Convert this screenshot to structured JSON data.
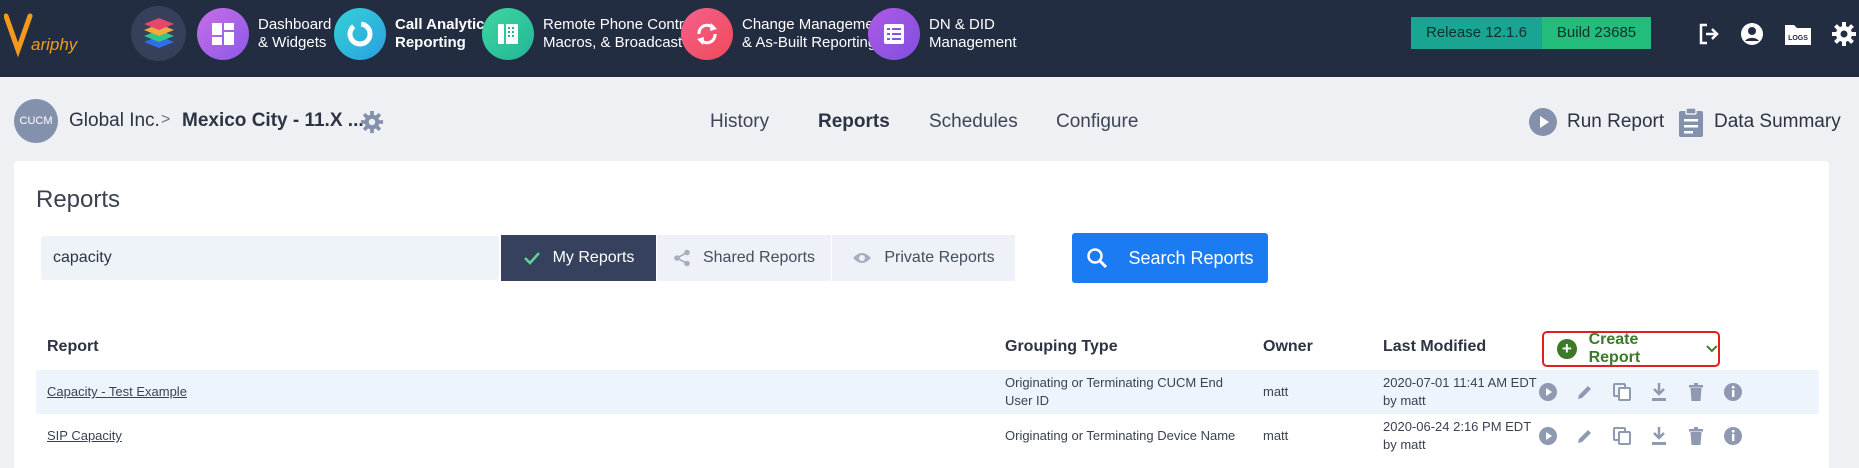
{
  "brand": {
    "name": "VARIPHY"
  },
  "topnav": [
    {
      "line1": "Dashboard",
      "line2": "& Widgets",
      "color": "#b65de6",
      "icon": "dashboard-icon"
    },
    {
      "line1": "Call Analytics",
      "line2": "Reporting",
      "color": "#2bc4d8",
      "icon": "call-analytics-icon",
      "active": true
    },
    {
      "line1": "Remote Phone Control,",
      "line2": "Macros, & Broadcast",
      "color": "#2ec79a",
      "icon": "remote-phone-icon"
    },
    {
      "line1": "Change Management",
      "line2": "& As-Built Reporting",
      "color": "#f0536d",
      "icon": "change-management-icon"
    },
    {
      "line1": "DN & DID",
      "line2": "Management",
      "color": "#9c4fe0",
      "icon": "dn-did-icon"
    }
  ],
  "release": {
    "release_label": "Release 12.1.6",
    "build_label": "Build 23685"
  },
  "top_icons": [
    "logout-icon",
    "user-icon",
    "logs-icon",
    "settings-icon"
  ],
  "logs_label": "LOGS",
  "breadcrumb": {
    "badge": "CUCM",
    "org": "Global Inc.",
    "separator": ">",
    "site": "Mexico City - 11.X ..."
  },
  "tabs": [
    {
      "label": "History",
      "active": false
    },
    {
      "label": "Reports",
      "active": true
    },
    {
      "label": "Schedules",
      "active": false
    },
    {
      "label": "Configure",
      "active": false
    }
  ],
  "actions": {
    "run_report": "Run Report",
    "data_summary": "Data Summary"
  },
  "main": {
    "title": "Reports",
    "search_value": "capacity",
    "filters": {
      "my_reports": "My Reports",
      "shared_reports": "Shared Reports",
      "private_reports": "Private Reports"
    },
    "search_button": "Search Reports",
    "create_button": "Create Report",
    "columns": {
      "report": "Report",
      "grouping_type": "Grouping Type",
      "owner": "Owner",
      "last_modified": "Last Modified"
    },
    "rows": [
      {
        "report": "Capacity - Test Example",
        "grouping_line1": "Originating or Terminating CUCM End",
        "grouping_line2": "User ID",
        "owner": "matt",
        "modified": "2020-07-01 11:41 AM EDT",
        "modified_by": "by matt"
      },
      {
        "report": "SIP Capacity",
        "grouping_line1": "Originating or Terminating Device Name",
        "grouping_line2": "",
        "owner": "matt",
        "modified": "2020-06-24 2:16 PM EDT",
        "modified_by": "by matt"
      }
    ]
  }
}
